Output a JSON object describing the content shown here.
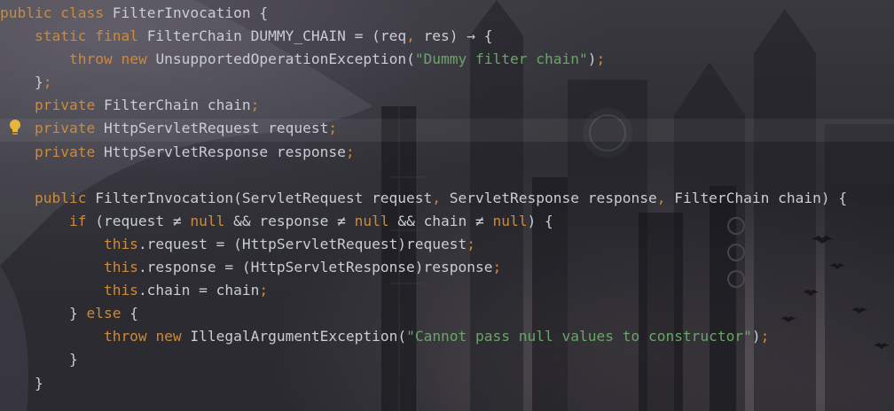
{
  "editor": {
    "theme_colors": {
      "keyword": "#cc8a3b",
      "string": "#6aa46a",
      "text": "#c9cdd4",
      "bulb": "#e8b53a"
    },
    "intention_icon": "lightbulb-icon",
    "lines": [
      [
        {
          "t": "public ",
          "c": "kw"
        },
        {
          "t": "class ",
          "c": "kw"
        },
        {
          "t": "FilterInvocation {",
          "c": "id"
        }
      ],
      [
        {
          "t": "    static ",
          "c": "kw"
        },
        {
          "t": "final ",
          "c": "kw"
        },
        {
          "t": "FilterChain DUMMY_CHAIN = (req",
          "c": "id"
        },
        {
          "t": ", ",
          "c": "pun"
        },
        {
          "t": "res) → {",
          "c": "id"
        }
      ],
      [
        {
          "t": "        throw ",
          "c": "kw"
        },
        {
          "t": "new ",
          "c": "kw"
        },
        {
          "t": "UnsupportedOperationException(",
          "c": "id"
        },
        {
          "t": "\"Dummy filter chain\"",
          "c": "str"
        },
        {
          "t": ")",
          "c": "id"
        },
        {
          "t": ";",
          "c": "pun"
        }
      ],
      [
        {
          "t": "    }",
          "c": "id"
        },
        {
          "t": ";",
          "c": "pun"
        }
      ],
      [
        {
          "t": "    private ",
          "c": "kw"
        },
        {
          "t": "FilterChain chain",
          "c": "id"
        },
        {
          "t": ";",
          "c": "pun"
        }
      ],
      [
        {
          "t": "    private ",
          "c": "kw"
        },
        {
          "t": "HttpServletRequest request",
          "c": "id"
        },
        {
          "t": ";",
          "c": "pun"
        }
      ],
      [
        {
          "t": "    private ",
          "c": "kw"
        },
        {
          "t": "HttpServletResponse response",
          "c": "id"
        },
        {
          "t": ";",
          "c": "pun"
        }
      ],
      [
        {
          "t": "",
          "c": "id"
        }
      ],
      [
        {
          "t": "    public ",
          "c": "kw"
        },
        {
          "t": "FilterInvocation(ServletRequest request",
          "c": "id"
        },
        {
          "t": ", ",
          "c": "pun"
        },
        {
          "t": "ServletResponse response",
          "c": "id"
        },
        {
          "t": ", ",
          "c": "pun"
        },
        {
          "t": "FilterChain chain) {",
          "c": "id"
        }
      ],
      [
        {
          "t": "        if ",
          "c": "kw"
        },
        {
          "t": "(request ≠ ",
          "c": "id"
        },
        {
          "t": "null ",
          "c": "kw"
        },
        {
          "t": "&& response ≠ ",
          "c": "id"
        },
        {
          "t": "null ",
          "c": "kw"
        },
        {
          "t": "&& chain ≠ ",
          "c": "id"
        },
        {
          "t": "null",
          "c": "kw"
        },
        {
          "t": ") {",
          "c": "id"
        }
      ],
      [
        {
          "t": "            this",
          "c": "kw"
        },
        {
          "t": ".request = (HttpServletRequest)request",
          "c": "id"
        },
        {
          "t": ";",
          "c": "pun"
        }
      ],
      [
        {
          "t": "            this",
          "c": "kw"
        },
        {
          "t": ".response = (HttpServletResponse)response",
          "c": "id"
        },
        {
          "t": ";",
          "c": "pun"
        }
      ],
      [
        {
          "t": "            this",
          "c": "kw"
        },
        {
          "t": ".chain = chain",
          "c": "id"
        },
        {
          "t": ";",
          "c": "pun"
        }
      ],
      [
        {
          "t": "        } ",
          "c": "id"
        },
        {
          "t": "else ",
          "c": "kw"
        },
        {
          "t": "{",
          "c": "id"
        }
      ],
      [
        {
          "t": "            throw ",
          "c": "kw"
        },
        {
          "t": "new ",
          "c": "kw"
        },
        {
          "t": "IllegalArgumentException(",
          "c": "id"
        },
        {
          "t": "\"Cannot pass null values to constructor\"",
          "c": "str"
        },
        {
          "t": ")",
          "c": "id"
        },
        {
          "t": ";",
          "c": "pun"
        }
      ],
      [
        {
          "t": "        }",
          "c": "id"
        }
      ],
      [
        {
          "t": "    }",
          "c": "id"
        }
      ]
    ]
  }
}
